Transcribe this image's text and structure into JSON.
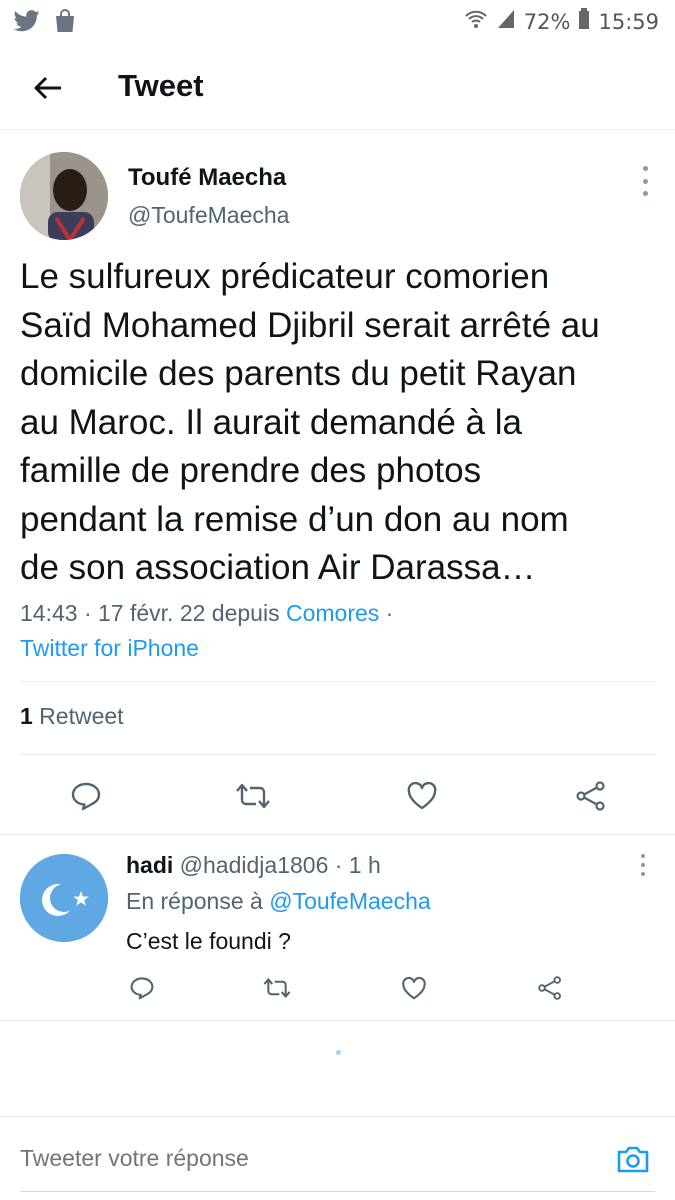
{
  "status_bar": {
    "left_icons": [
      "twitter-bird-icon",
      "shopping-bag-icon"
    ],
    "battery": "72%",
    "time": "15:59"
  },
  "header": {
    "title": "Tweet",
    "back_icon": "arrow-left-icon"
  },
  "tweet": {
    "author_name": "Toufé Maecha",
    "author_handle": "@ToufeMaecha",
    "text_lines": [
      "Le sulfureux prédicateur comorien",
      "Saïd Mohamed Djibril serait arrêté au",
      "domicile des parents du petit Rayan",
      "au Maroc. Il aurait demandé à la",
      "famille de prendre des photos",
      "pendant la remise d’un don au nom",
      "de son association Air Darassa…"
    ],
    "meta_time": "14:43 · 17 févr. 22 depuis ",
    "meta_location": "Comores",
    "meta_sep": " ·",
    "meta_source": "Twitter for iPhone",
    "retweet_count": "1",
    "retweet_label": " Retweet"
  },
  "reply": {
    "name": "hadi",
    "handle_time": " @hadidja1806 · 1 h",
    "replying_to_label": "En réponse à ",
    "replying_to_handle": "@ToufeMaecha",
    "text": "C’est le foundi ?"
  },
  "composer": {
    "placeholder": "Tweeter votre réponse",
    "camera_icon": "camera-icon"
  },
  "colors": {
    "accent": "#1d9bf0",
    "text": "#0f1419",
    "muted": "#536471",
    "divider": "#e6ecf0"
  }
}
